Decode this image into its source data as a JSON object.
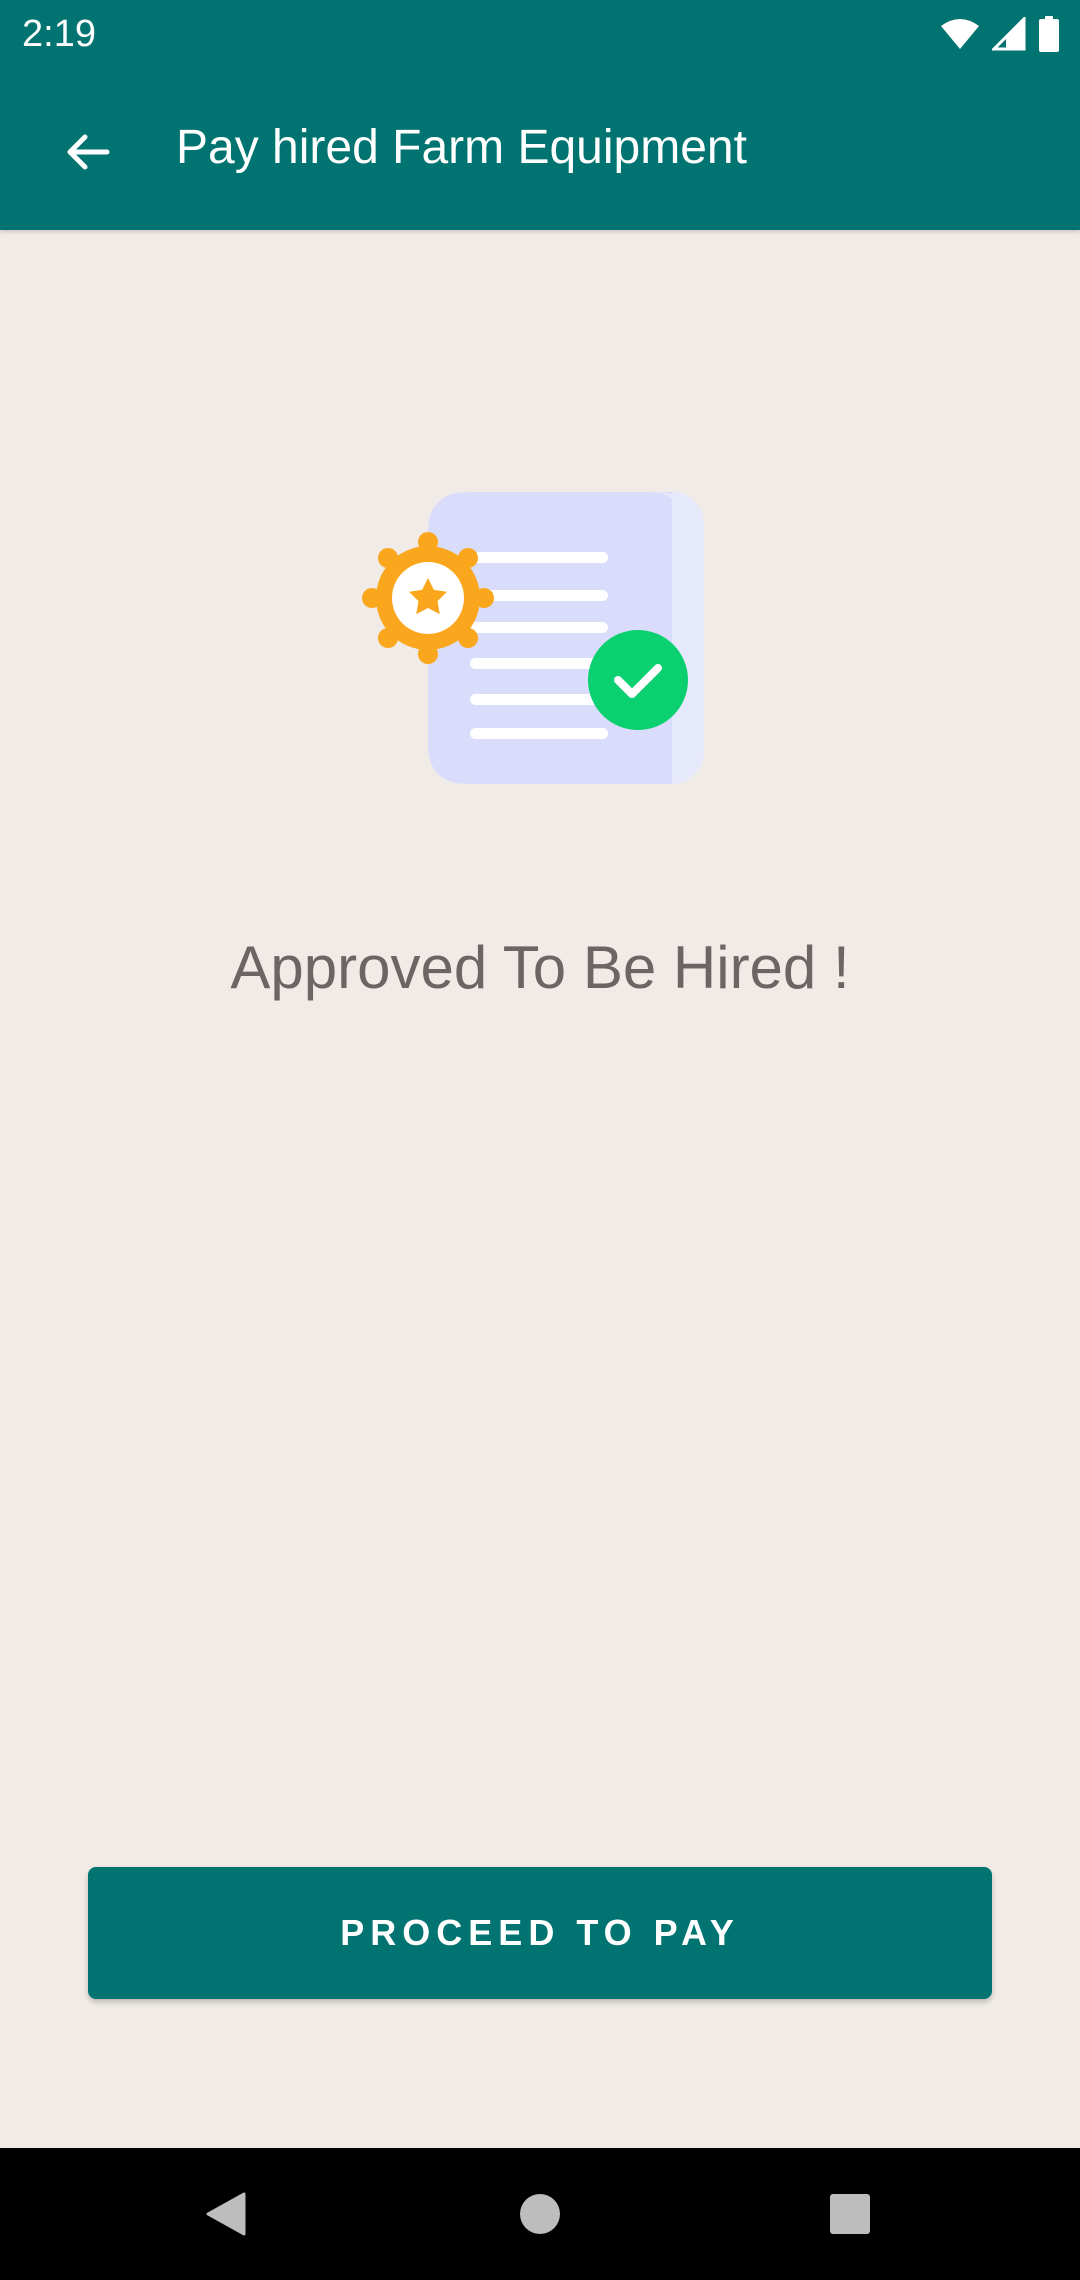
{
  "status_bar": {
    "time": "2:19",
    "icons": [
      "wifi-icon",
      "cellular-signal-icon",
      "battery-icon"
    ]
  },
  "app_bar": {
    "back_icon": "arrow-back-icon",
    "title": "Pay hired Farm Equipment",
    "background_color": "#017370"
  },
  "main": {
    "illustration": "approved-document-icon",
    "status_message": "Approved To Be Hired !"
  },
  "actions": {
    "proceed_label": "PROCEED TO PAY",
    "button_color": "#017370"
  },
  "nav_bar": {
    "icons": [
      "nav-back-icon",
      "nav-home-icon",
      "nav-recents-icon"
    ]
  },
  "colors": {
    "background": "#f0ebe7",
    "text_secondary": "#6b6664",
    "check_green": "#0ad06f",
    "badge_orange": "#fba71d",
    "document_lavender": "#d9ddfb"
  }
}
